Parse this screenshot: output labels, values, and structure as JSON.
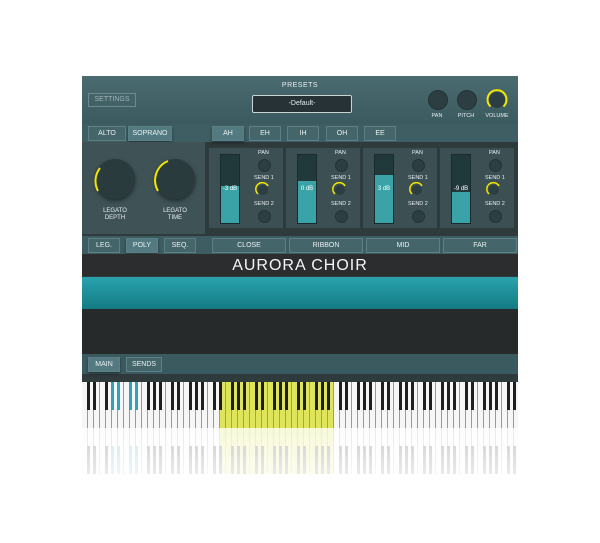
{
  "header": {
    "presets_label": "PRESETS",
    "preset_value": "-Default-",
    "settings_label": "SETTINGS",
    "master_knobs": [
      {
        "label": "PAN"
      },
      {
        "label": "PITCH"
      },
      {
        "label": "VOLUME"
      }
    ]
  },
  "voices": [
    "ALTO",
    "SOPRANO"
  ],
  "selected_voice": "SOPRANO",
  "vowels": [
    "AH",
    "EH",
    "IH",
    "OH",
    "EE"
  ],
  "selected_vowel": "AH",
  "legato": {
    "depth_label": "LEGATO\nDEPTH",
    "time_label": "LEGATO\nTIME"
  },
  "mixer": {
    "pan_label": "PAN",
    "send1_label": "SEND 1",
    "send2_label": "SEND 2",
    "channels": [
      {
        "level": "-3 dB",
        "fill": 0.55
      },
      {
        "level": "0 dB",
        "fill": 0.62
      },
      {
        "level": "3 dB",
        "fill": 0.7
      },
      {
        "level": "-9 dB",
        "fill": 0.46
      }
    ]
  },
  "modes": [
    "LEG.",
    "POLY",
    "SEQ."
  ],
  "selected_mode": "POLY",
  "mics": [
    "CLOSE",
    "RIBBON",
    "MID",
    "FAR"
  ],
  "instrument_title": "AURORA CHOIR",
  "bottom_tabs": [
    "MAIN",
    "SENDS"
  ],
  "selected_bottom_tab": "MAIN",
  "colors": {
    "accent_teal": "#2aa3ad",
    "knob_ring": "#f2e600",
    "keyswitch_blue": "#2fa2bf",
    "range_yellow": "#dfe55a"
  },
  "icons": [
    "knob-icon",
    "fader-icon"
  ]
}
